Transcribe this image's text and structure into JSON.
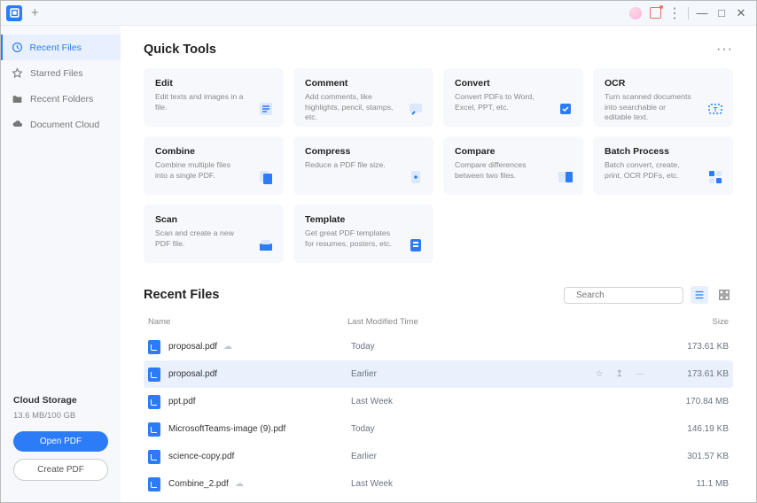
{
  "sidebar": {
    "items": [
      {
        "label": "Recent Files"
      },
      {
        "label": "Starred Files"
      },
      {
        "label": "Recent Folders"
      },
      {
        "label": "Document Cloud"
      }
    ],
    "cloud_heading": "Cloud Storage",
    "cloud_usage": "13.6 MB/100 GB",
    "open_btn": "Open PDF",
    "create_btn": "Create PDF"
  },
  "quick_tools": {
    "heading": "Quick Tools",
    "cards": [
      {
        "title": "Edit",
        "desc": "Edit texts and images in a file."
      },
      {
        "title": "Comment",
        "desc": "Add comments, like highlights, pencil, stamps, etc."
      },
      {
        "title": "Convert",
        "desc": "Convert PDFs to Word, Excel, PPT, etc."
      },
      {
        "title": "OCR",
        "desc": "Turn scanned documents into searchable or editable text."
      },
      {
        "title": "Combine",
        "desc": "Combine multiple files into a single PDF."
      },
      {
        "title": "Compress",
        "desc": "Reduce a PDF file size."
      },
      {
        "title": "Compare",
        "desc": "Compare differences between two files."
      },
      {
        "title": "Batch Process",
        "desc": "Batch convert, create, print, OCR PDFs, etc."
      },
      {
        "title": "Scan",
        "desc": "Scan and create a new PDF file."
      },
      {
        "title": "Template",
        "desc": "Get great PDF templates for resumes, posters, etc."
      }
    ]
  },
  "recent_files": {
    "heading": "Recent Files",
    "search_placeholder": "Search",
    "columns": {
      "name": "Name",
      "modified": "Last Modified Time",
      "size": "Size"
    },
    "rows": [
      {
        "name": "proposal.pdf",
        "modified": "Today",
        "size": "173.61 KB",
        "cloud": true
      },
      {
        "name": "proposal.pdf",
        "modified": "Earlier",
        "size": "173.61 KB",
        "selected": true
      },
      {
        "name": "ppt.pdf",
        "modified": "Last Week",
        "size": "170.84 MB"
      },
      {
        "name": "MicrosoftTeams-image (9).pdf",
        "modified": "Today",
        "size": "146.19 KB"
      },
      {
        "name": "science-copy.pdf",
        "modified": "Earlier",
        "size": "301.57 KB"
      },
      {
        "name": "Combine_2.pdf",
        "modified": "Last Week",
        "size": "11.1 MB",
        "cloud": true
      }
    ]
  }
}
